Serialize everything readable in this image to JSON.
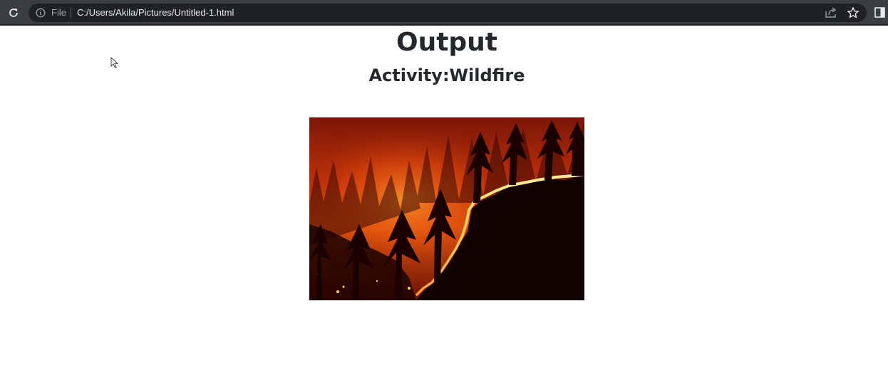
{
  "browser": {
    "scheme_label": "File",
    "url": "C:/Users/Akila/Pictures/Untitled-1.html",
    "icons": [
      "reload-icon",
      "info-icon",
      "share-icon",
      "star-icon",
      "side-panel-icon"
    ],
    "colors": {
      "toolbar": "#3c3d40",
      "omnibox": "#202124",
      "url_text": "#e8eaed"
    }
  },
  "page": {
    "title": "Output",
    "subtitle": "Activity:Wildfire",
    "image": {
      "subject": "forest wildfire at night"
    },
    "colors": {
      "text": "#25292d",
      "background": "#ffffff"
    }
  }
}
